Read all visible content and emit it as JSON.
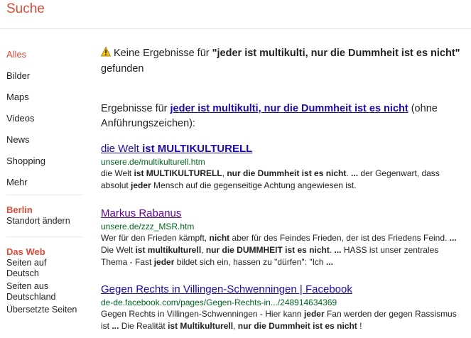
{
  "header": {
    "title": "Suche"
  },
  "sidebar": {
    "items": [
      {
        "label": "Alles",
        "active": true
      },
      {
        "label": "Bilder"
      },
      {
        "label": "Maps"
      },
      {
        "label": "Videos"
      },
      {
        "label": "News"
      },
      {
        "label": "Shopping"
      },
      {
        "label": "Mehr"
      }
    ],
    "location": {
      "heading": "Berlin",
      "change": "Standort ändern"
    },
    "web": {
      "heading": "Das Web",
      "options": [
        "Seiten auf Deutsch",
        "Seiten aus Deutschland",
        "Übersetzte Seiten"
      ]
    }
  },
  "no_results": {
    "prefix": "Keine Ergebnisse für ",
    "query": "\"jeder ist multikulti, nur die Dummheit ist es nicht\"",
    "suffix": " gefunden"
  },
  "instead": {
    "prefix": "Ergebnisse für ",
    "query": "jeder ist multikulti, nur die Dummheit ist es nicht",
    "suffix": " (ohne Anführungszeichen):"
  },
  "results": [
    {
      "title_plain": "die Welt ",
      "title_bold": "ist MULTIKULTURELL",
      "url": "unsere.de/multikulturell.htm",
      "snippet": [
        {
          "t": "die Welt "
        },
        {
          "b": "ist MULTIKULTURELL"
        },
        {
          "t": ", "
        },
        {
          "b": "nur die Dummheit ist es nicht"
        },
        {
          "t": ". "
        },
        {
          "b": "..."
        },
        {
          "t": " der Gegenwart, dass absolut "
        },
        {
          "b": "jeder"
        },
        {
          "t": " Mensch auf die gegenseitige Achtung angewiesen ist."
        }
      ]
    },
    {
      "title_plain": "Markus Rabanus",
      "title_bold": "",
      "url": "unsere.de/zzz_MSR.htm",
      "snippet": [
        {
          "t": "Wer für den Frieden kämpft, "
        },
        {
          "b": "nicht"
        },
        {
          "t": " aber für des Feindes Frieden, der ist des Friedens Feind. "
        },
        {
          "b": "..."
        },
        {
          "t": " Die Welt "
        },
        {
          "b": "ist multikulturell"
        },
        {
          "t": ", "
        },
        {
          "b": "nur die DUMMHEIT ist es nicht"
        },
        {
          "t": ". "
        },
        {
          "b": "..."
        },
        {
          "t": " HASS ist unser zentrales Thema - Fast "
        },
        {
          "b": "jeder"
        },
        {
          "t": " bildet sich ein, hassen zu \"dürfen\": \"Ich "
        },
        {
          "b": "..."
        }
      ]
    },
    {
      "title_plain": "Gegen Rechts in Villingen-Schwenningen | Facebook",
      "title_bold": "",
      "url": "de-de.facebook.com/pages/Gegen-Rechts-in.../248914634369",
      "snippet": [
        {
          "t": "Gegen Rechts in Villingen-Schwenningen - Hier kann "
        },
        {
          "b": "jeder"
        },
        {
          "t": " Fan werden der gegen Rassismus ist "
        },
        {
          "b": "..."
        },
        {
          "t": " Die Realität "
        },
        {
          "b": "ist Multikulturell"
        },
        {
          "t": ", "
        },
        {
          "b": "nur die Dummheit ist es nicht"
        },
        {
          "t": " !"
        }
      ]
    }
  ],
  "colors": {
    "accent": "#dd4b39",
    "link": "#1a0dab",
    "visited": "#660099",
    "url": "#006621",
    "warning": "#f5c211"
  },
  "icons": {
    "warning": "warning-icon"
  }
}
